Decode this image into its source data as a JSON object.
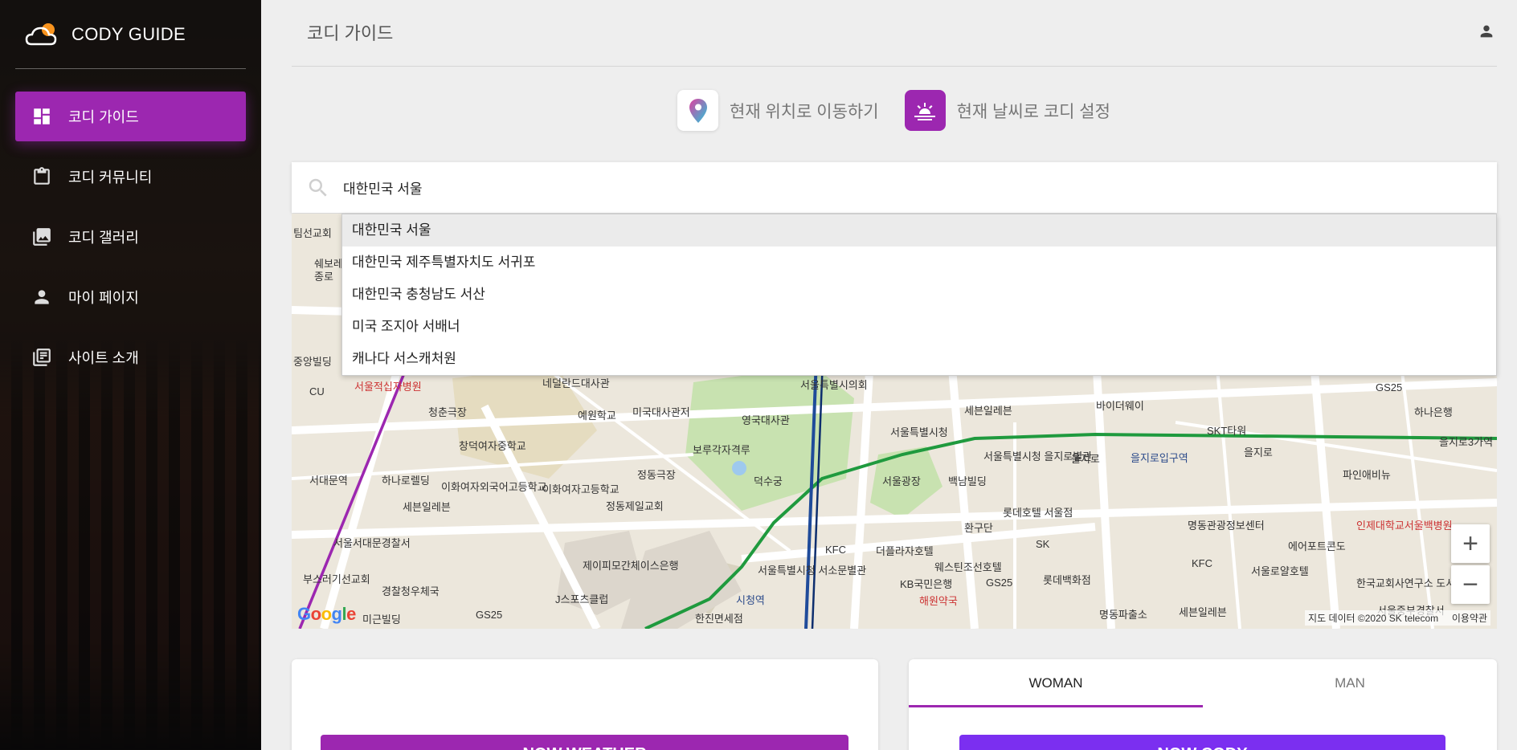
{
  "sidebar": {
    "brand": "CODY GUIDE",
    "items": [
      {
        "label": "코디 가이드",
        "icon": "dashboard-icon",
        "active": true
      },
      {
        "label": "코디 커뮤니티",
        "icon": "clipboard-icon",
        "active": false
      },
      {
        "label": "코디 갤러리",
        "icon": "gallery-icon",
        "active": false
      },
      {
        "label": "마이 페이지",
        "icon": "person-icon",
        "active": false
      },
      {
        "label": "사이트 소개",
        "icon": "library-books-icon",
        "active": false
      }
    ]
  },
  "header": {
    "title": "코디 가이드"
  },
  "actions": {
    "move_location": "현재 위치로 이동하기",
    "weather_cody": "현재 날씨로 코디 설정"
  },
  "search": {
    "value": "대한민국 서울"
  },
  "autocomplete": [
    "대한민국 서울",
    "대한민국 제주특별자치도 서귀포",
    "대한민국 충청남도 서산",
    "미국 조지아 서배너",
    "캐나다 서스캐처원"
  ],
  "map": {
    "attribution": "지도 데이터 ©2020 SK telecom",
    "terms": "이용약관",
    "google": "Google",
    "zoom_in": "+",
    "zoom_out": "−",
    "labels": [
      "팀선교회",
      "쉐보레",
      "종로",
      "중앙빌딩",
      "서울적십자병원",
      "네덜란드대사관",
      "서울특별시의회",
      "청춘극장",
      "예원학교",
      "미국대사관저",
      "영국대사관",
      "세븐일레븐",
      "바이더웨이",
      "GS25",
      "하나은행",
      "서울특별시청",
      "SKT타워",
      "을지로3가역",
      "창덕여자중학교",
      "보루각자격루",
      "서울특별시청 을지로별관",
      "을지로",
      "을지로입구역",
      "을지로",
      "서대문역",
      "하나로렐딩",
      "이화여자외국어고등학교",
      "이화여자고등학교",
      "정동극장",
      "덕수궁",
      "서울광장",
      "백남빌딩",
      "파인애비뉴",
      "세븐일레븐",
      "정동제일교회",
      "환구단",
      "롯데호텔 서울점",
      "명동관광정보센터",
      "인제대학교서울백병원",
      "서울서대문경찰서",
      "KFC",
      "더플라자호텔",
      "SK",
      "에어포트콘도",
      "제이피모간체이스은행",
      "서울특별시청 서소문별관",
      "웨스틴조선호텔",
      "KFC",
      "서울로얄호텔",
      "부스러기선교회",
      "경찰청우체국",
      "KB국민은행",
      "롯데백화점",
      "한국교회사연구소 도서실",
      "J스포츠클럽",
      "시청역",
      "해원약국",
      "GS25",
      "세븐일레븐",
      "서울중부경찰서",
      "미근빌딩",
      "GS25",
      "한진면세점",
      "명동파출소",
      "CU"
    ]
  },
  "cards": {
    "weather_button": "NOW WEATHER",
    "tab_woman": "WOMAN",
    "tab_man": "MAN",
    "cody_button": "NOW CODY"
  },
  "colors": {
    "accent": "#9c27b0",
    "cody_button": "#7b2ff0"
  }
}
